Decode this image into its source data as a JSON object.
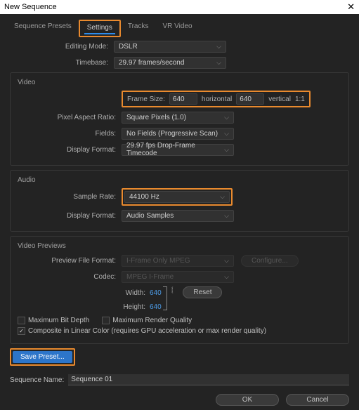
{
  "window": {
    "title": "New Sequence",
    "close": "✕"
  },
  "tabs": {
    "presets": "Sequence Presets",
    "settings": "Settings",
    "tracks": "Tracks",
    "vr": "VR Video"
  },
  "top": {
    "editing_mode_label": "Editing Mode:",
    "editing_mode_value": "DSLR",
    "timebase_label": "Timebase:",
    "timebase_value": "29.97 frames/second"
  },
  "video": {
    "title": "Video",
    "frame_size_label": "Frame Size:",
    "frame_w": "640",
    "horizontal": "horizontal",
    "frame_h": "640",
    "vertical": "vertical",
    "ratio": "1:1",
    "par_label": "Pixel Aspect Ratio:",
    "par_value": "Square Pixels (1.0)",
    "fields_label": "Fields:",
    "fields_value": "No Fields (Progressive Scan)",
    "disp_label": "Display Format:",
    "disp_value": "29.97 fps Drop-Frame Timecode"
  },
  "audio": {
    "title": "Audio",
    "rate_label": "Sample Rate:",
    "rate_value": "44100 Hz",
    "disp_label": "Display Format:",
    "disp_value": "Audio Samples"
  },
  "previews": {
    "title": "Video Previews",
    "format_label": "Preview File Format:",
    "format_value": "I-Frame Only MPEG",
    "configure": "Configure...",
    "codec_label": "Codec:",
    "codec_value": "MPEG I-Frame",
    "width_label": "Width:",
    "width_value": "640",
    "height_label": "Height:",
    "height_value": "640",
    "reset": "Reset",
    "max_bit": "Maximum Bit Depth",
    "max_render": "Maximum Render Quality",
    "composite": "Composite in Linear Color (requires GPU acceleration or max render quality)"
  },
  "save_preset": "Save Preset...",
  "seq": {
    "label": "Sequence Name:",
    "value": "Sequence 01"
  },
  "footer": {
    "ok": "OK",
    "cancel": "Cancel"
  }
}
